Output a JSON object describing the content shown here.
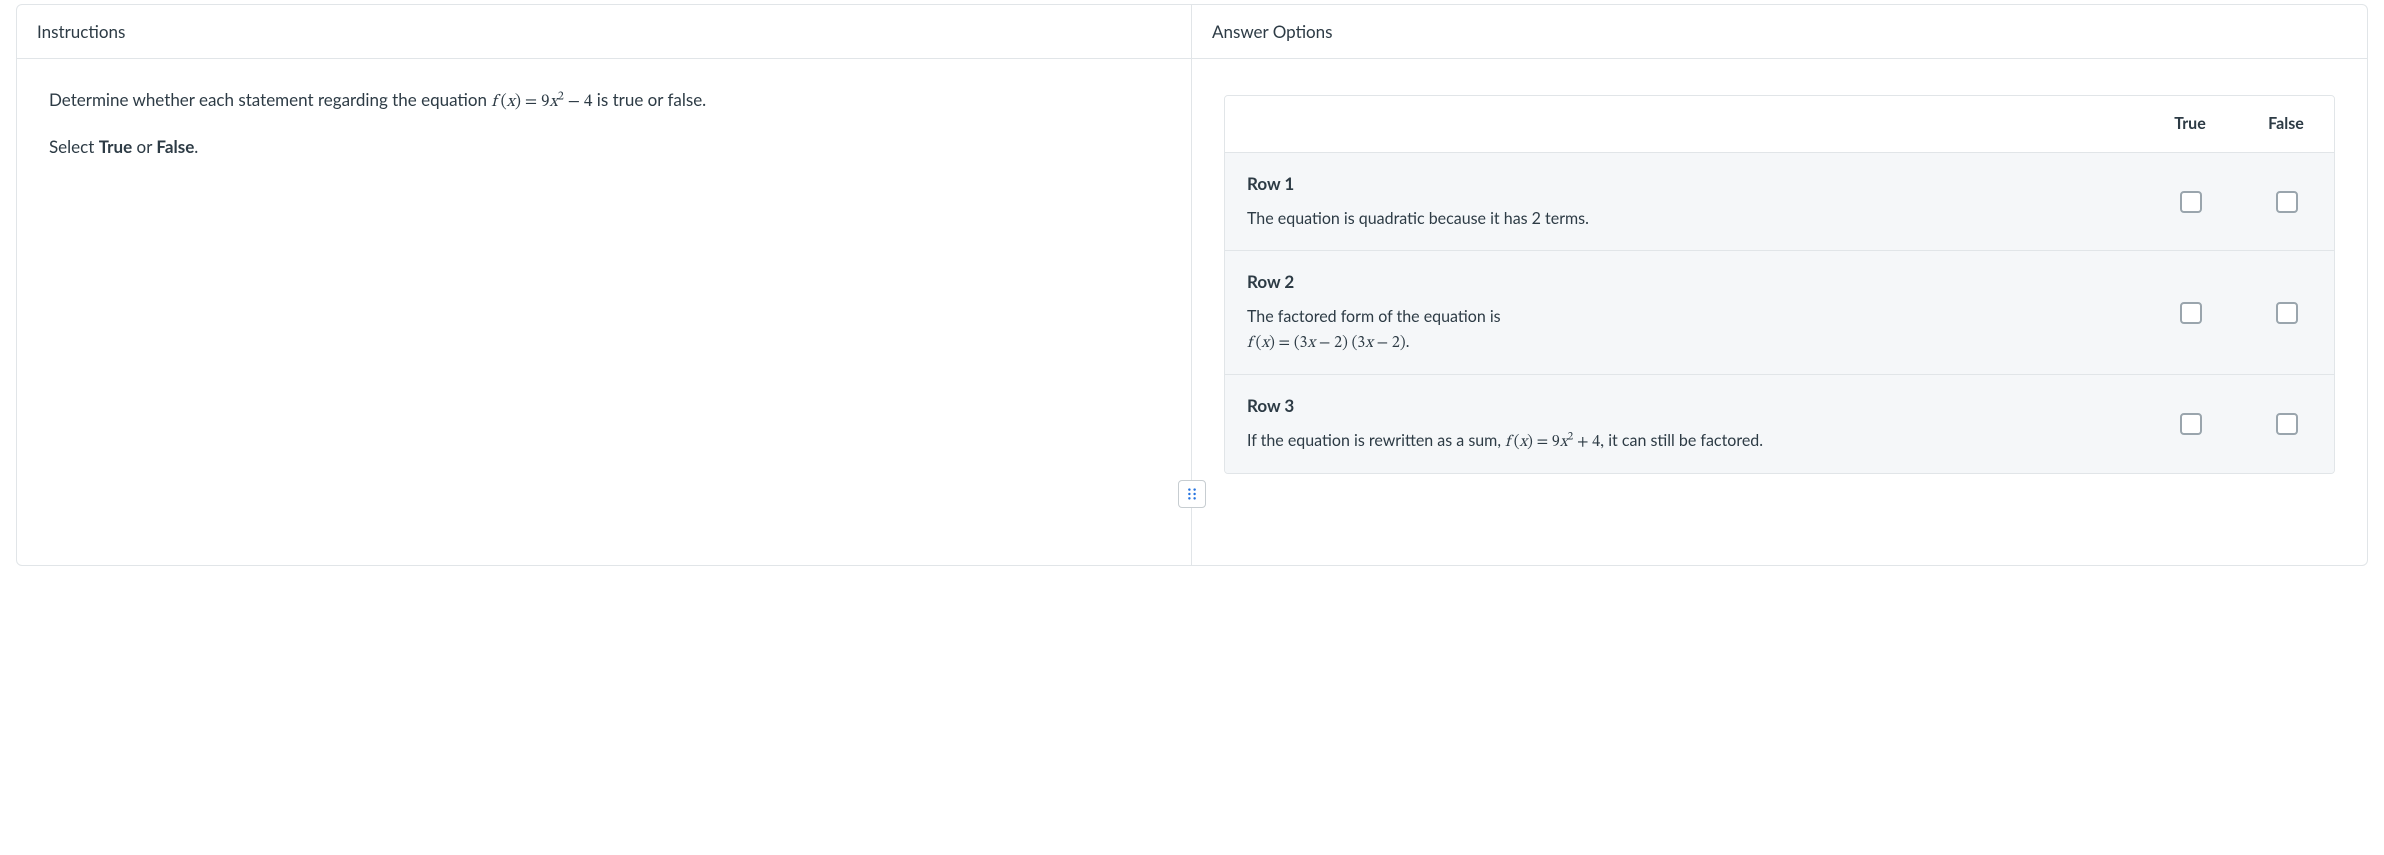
{
  "left": {
    "header": "Instructions",
    "line1_pre": "Determine whether each statement regarding the equation ",
    "line1_math_html": "<span class='it'>f</span>&nbsp;(<span class='it'>x</span>) = 9<span class='it'>x</span><sup>2</sup> − 4",
    "line1_post": " is true or false.",
    "line2_pre": "Select ",
    "line2_true": "True",
    "line2_mid": " or ",
    "line2_false": "False",
    "line2_post": "."
  },
  "right": {
    "header": "Answer Options",
    "col_true": "True",
    "col_false": "False",
    "rows": [
      {
        "title": "Row 1",
        "text_html": "The equation is quadratic because it has 2 terms."
      },
      {
        "title": "Row 2",
        "text_html": "The factored form of the equation is<br><span class='math'><span class='it'>f</span>&nbsp;(<span class='it'>x</span>) = (3<span class='it'>x</span> − 2) (3<span class='it'>x</span> − 2).</span>"
      },
      {
        "title": "Row 3",
        "text_html": "If the equation is rewritten as a sum, <span class='math'><span class='it'>f</span>&nbsp;(<span class='it'>x</span>) = 9<span class='it'>x</span><sup>2</sup> + 4,</span> it can still be factored."
      }
    ]
  }
}
